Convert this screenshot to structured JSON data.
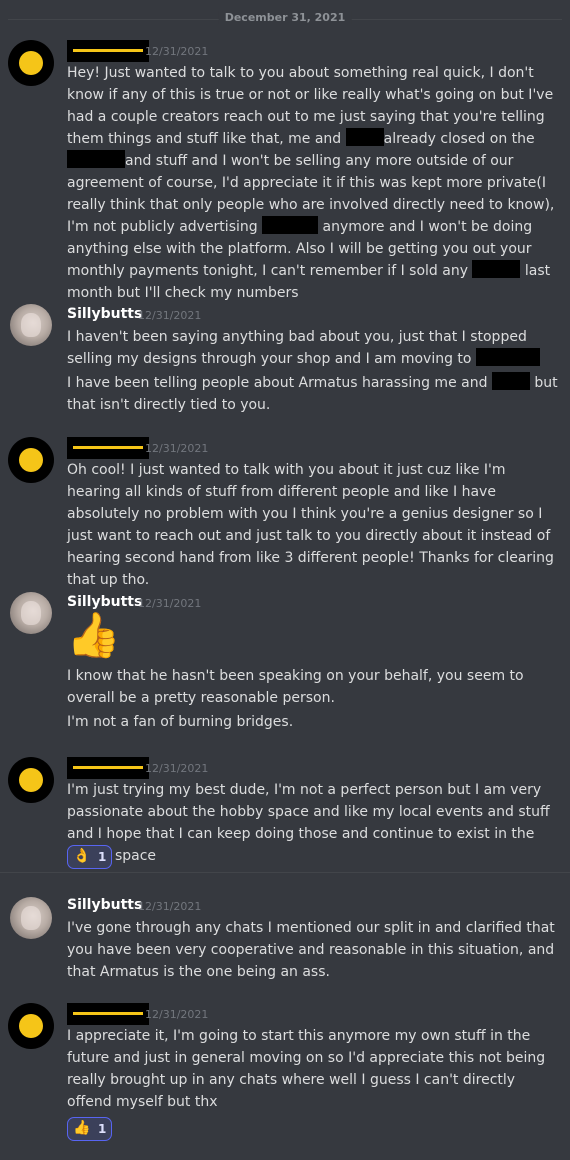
{
  "date_divider": "December 31, 2021",
  "messages": [
    {
      "author": "",
      "timestamp": "12/31/2021",
      "segments": {
        "a": "Hey! Just wanted to talk to you about something real quick, I don't know if any of this is true or not or like really what's going on but I've had a couple creators reach out to me just saying that you're telling them things and stuff like that, me and",
        "b": "already closed on the",
        "c": "and stuff and I won't be selling any more outside of our agreement of course, I'd appreciate it if this was kept more private(I really think that only people who are involved directly need to know), I'm not publicly advertising",
        "d": "anymore and I won't be doing anything else with the platform. Also I will be getting you out your monthly payments tonight, I can't remember if I sold any",
        "e": "last month but I'll check my numbers"
      }
    },
    {
      "author": "Sillybutts",
      "timestamp": "12/31/2021",
      "line1": "I haven't been saying anything bad about you, just that I stopped selling my designs through your shop and I am moving to",
      "line2a": "I have been telling people about Armatus harassing me and",
      "line2b": "but that isn't directly tied to you."
    },
    {
      "author": "",
      "timestamp": "12/31/2021",
      "text": "Oh cool! I just wanted to talk with you about it just cuz like I'm hearing all kinds of stuff from different people and like I have absolutely no problem with you I think you're a genius designer so I just want to reach out and just talk to you directly about it instead of hearing second hand from like 3 different people! Thanks for clearing that up tho."
    },
    {
      "author": "Sillybutts",
      "timestamp": "12/31/2021",
      "emoji": "👍",
      "line1": "I know that he hasn't been speaking on your behalf, you seem to overall be a pretty reasonable person.",
      "line2": "I'm not a fan of burning bridges."
    },
    {
      "author": "",
      "timestamp": "12/31/2021",
      "text": "I'm just trying my best dude, I'm not a perfect person but I am very passionate about the hobby space and like my local events and stuff and I hope that I can keep doing those and continue to exist in the hobby space",
      "reaction": {
        "emoji": "👌",
        "count": "1"
      }
    },
    {
      "author": "Sillybutts",
      "timestamp": "12/31/2021",
      "text": "I've gone through any chats I mentioned our split in and clarified that you have been very cooperative and reasonable in this situation, and that Armatus is the one being an ass."
    },
    {
      "author": "",
      "timestamp": "12/31/2021",
      "text": "I appreciate it, I'm going to start this anymore my own stuff in the future and just in general moving on so I'd appreciate this not being really brought up in any chats where well I guess I can't directly offend myself but thx",
      "reaction": {
        "emoji": "👍",
        "count": "1"
      }
    }
  ],
  "colors": {
    "background": "#36393f",
    "text": "#dcddde",
    "timestamp": "#72767d",
    "reaction_border": "#5865f2",
    "avatar_dot": "#f5c518"
  }
}
